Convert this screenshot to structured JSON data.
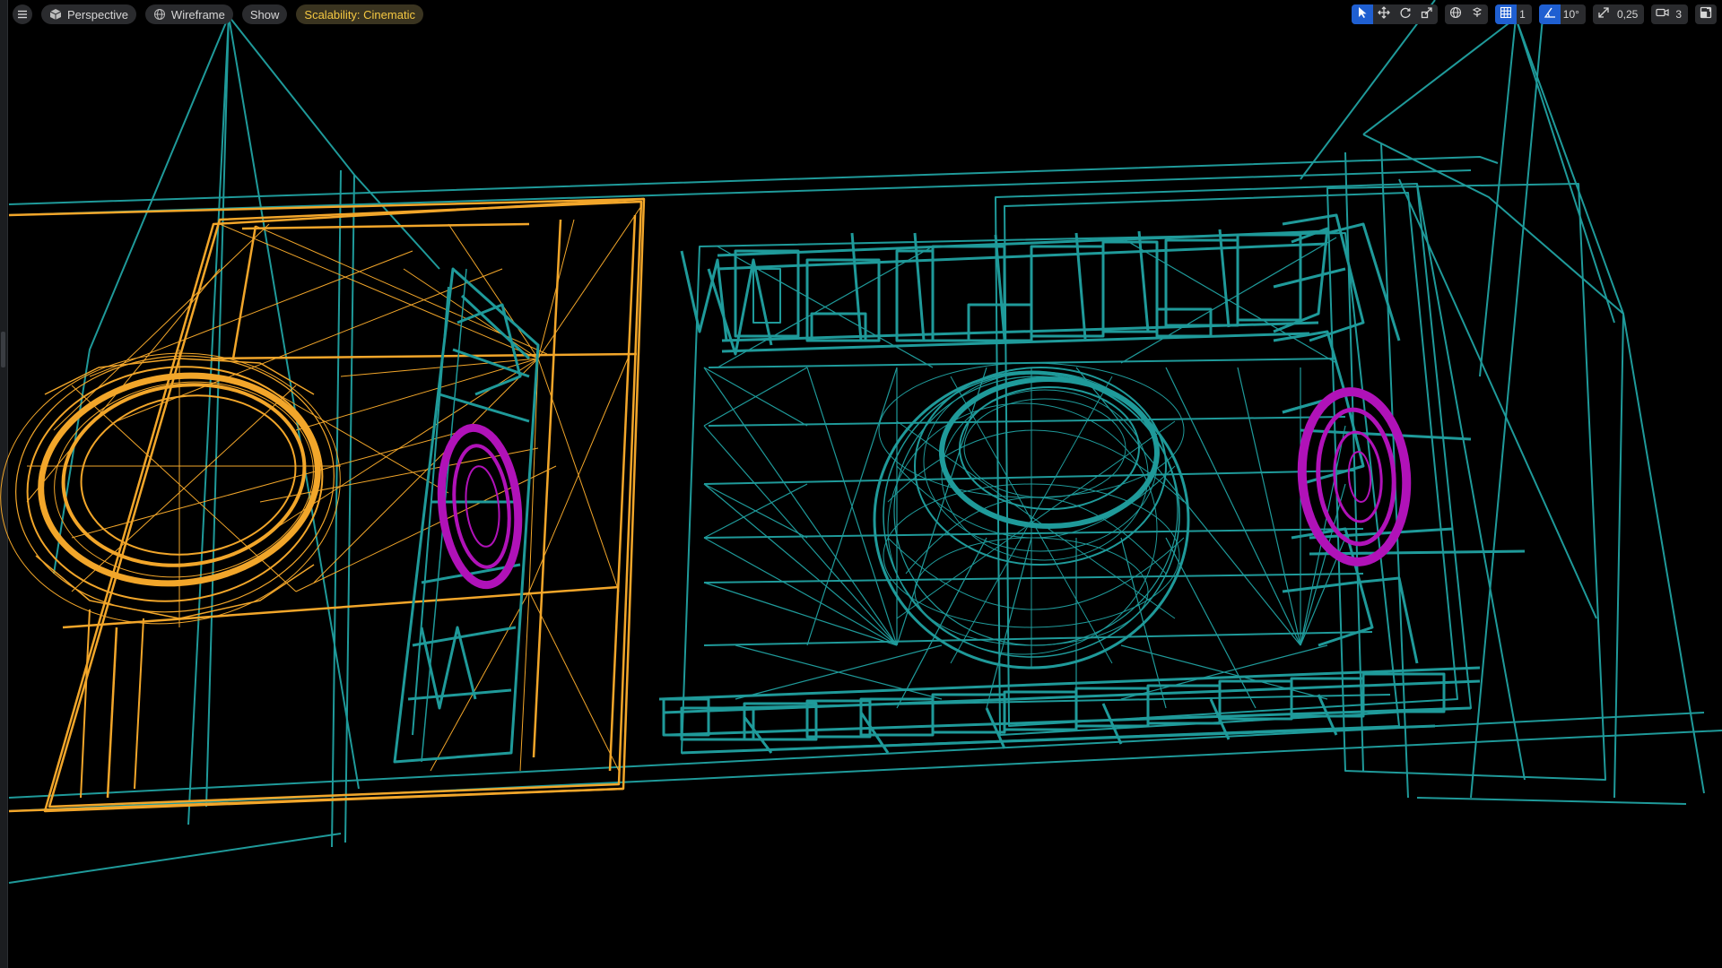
{
  "toolbar_left": {
    "menu_icon": "hamburger-menu-icon",
    "perspective_label": "Perspective",
    "view_mode_label": "Wireframe",
    "show_label": "Show",
    "scalability_label": "Scalability: Cinematic"
  },
  "toolbar_right": {
    "grid_snap_value": "1",
    "rotation_snap_value": "10°",
    "scale_snap_value": "0,25",
    "camera_speed_value": "3"
  },
  "colors": {
    "wire_teal": "#1f9a9a",
    "wire_orange": "#f2a62a",
    "wire_magenta": "#b012b8",
    "active_blue": "#1f5fd1",
    "scalability_yellow": "#f5c842"
  }
}
